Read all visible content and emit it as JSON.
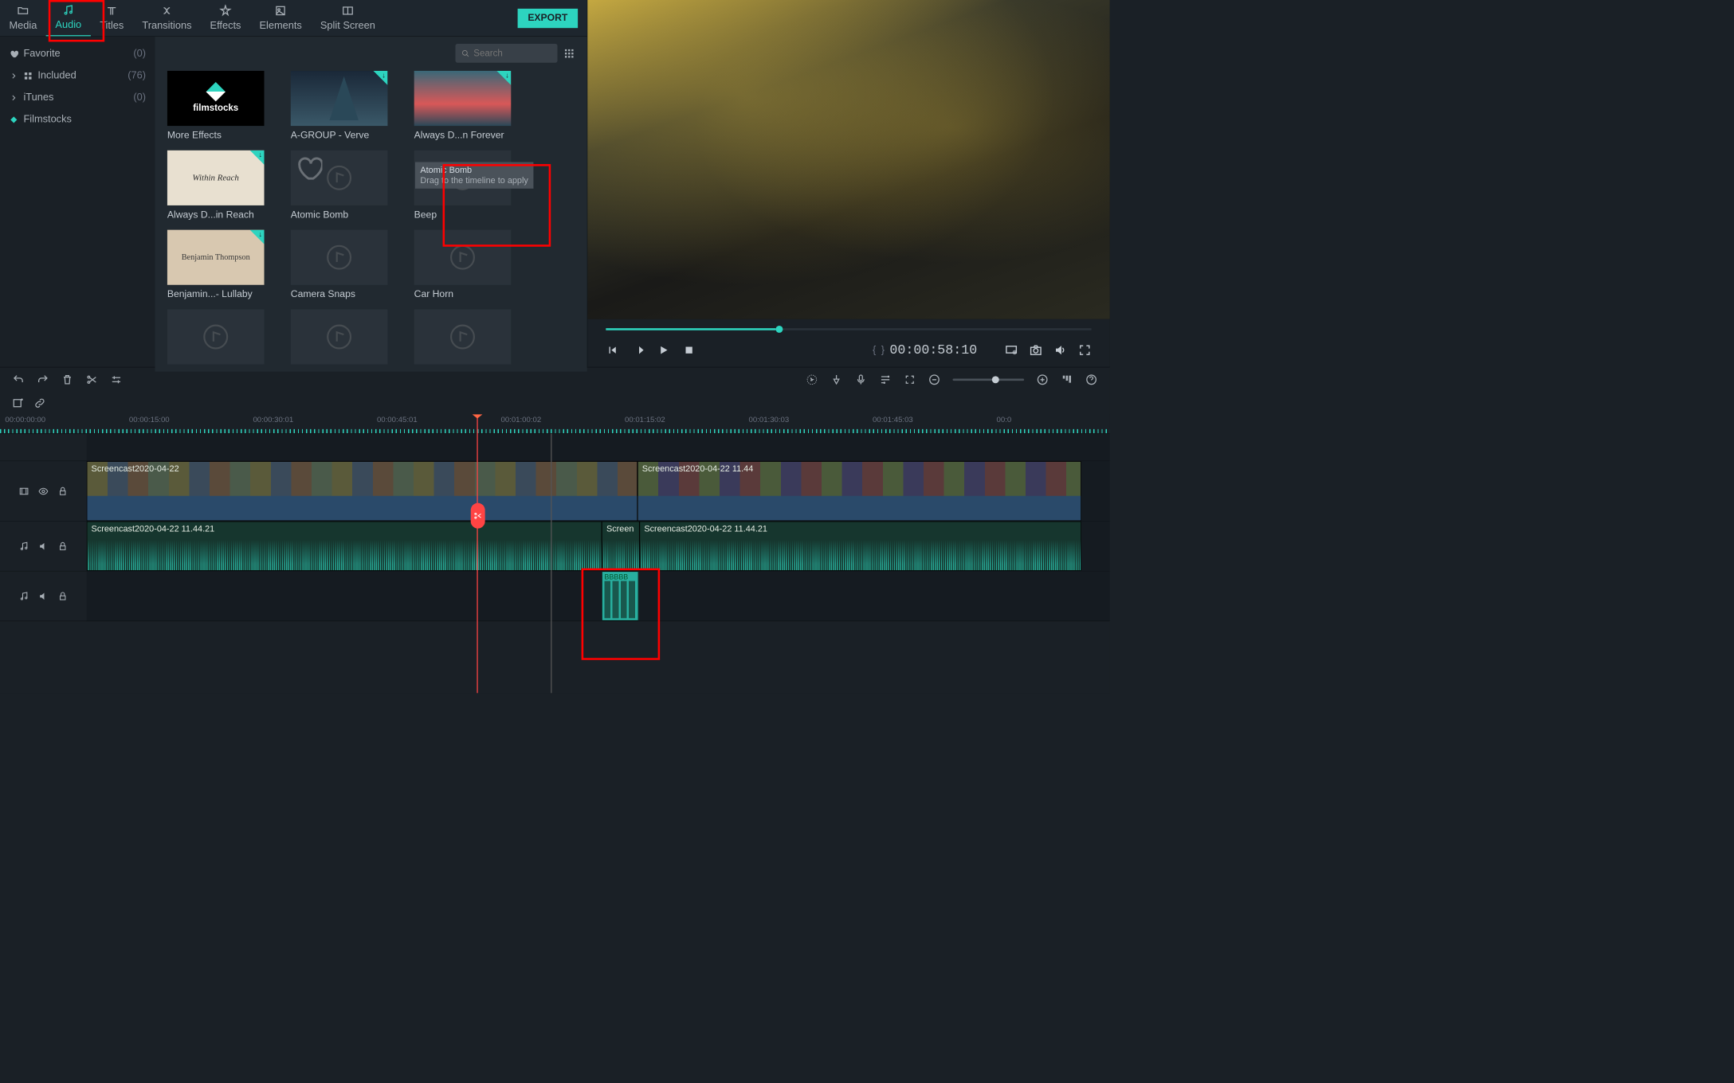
{
  "tabs": {
    "media": "Media",
    "audio": "Audio",
    "titles": "Titles",
    "transitions": "Transitions",
    "effects": "Effects",
    "elements": "Elements",
    "split_screen": "Split Screen"
  },
  "export_label": "EXPORT",
  "sidebar": {
    "favorite": {
      "label": "Favorite",
      "count": "(0)"
    },
    "included": {
      "label": "Included",
      "count": "(76)"
    },
    "itunes": {
      "label": "iTunes",
      "count": "(0)"
    },
    "filmstocks": {
      "label": "Filmstocks"
    }
  },
  "search_placeholder": "Search",
  "thumbs": {
    "more_effects": "More Effects",
    "agroup": "A-GROUP - Verve",
    "always1": "Always D...n Forever",
    "always2": "Always D...in Reach",
    "atomic": "Atomic Bomb",
    "beep": "Beep",
    "benjamin": "Benjamin...- Lullaby",
    "camera": "Camera Snaps",
    "carhorn": "Car Horn",
    "within_reach_art": "Within Reach",
    "benjamin_art": "Benjamin\nThompson",
    "filmstocks_art": "filmstocks"
  },
  "tooltip": {
    "title": "Atomic Bomb",
    "body": "Drag to the timeline to apply"
  },
  "preview": {
    "timecode": "00:00:58:10"
  },
  "timeline": {
    "ruler": [
      "00:00:00:00",
      "00:00:15:00",
      "00:00:30:01",
      "00:00:45:01",
      "00:01:00:02",
      "00:01:15:02",
      "00:01:30:03",
      "00:01:45:03",
      "00:0"
    ],
    "video_clip1": "Screencast2020-04-22",
    "video_clip2": "Screencast2020-04-22 11.44",
    "audio_clip1": "Screencast2020-04-22 11.44.21",
    "audio_clip2": "Screen",
    "audio_clip3": "Screencast2020-04-22 11.44.21",
    "beep": "BBBBB"
  }
}
